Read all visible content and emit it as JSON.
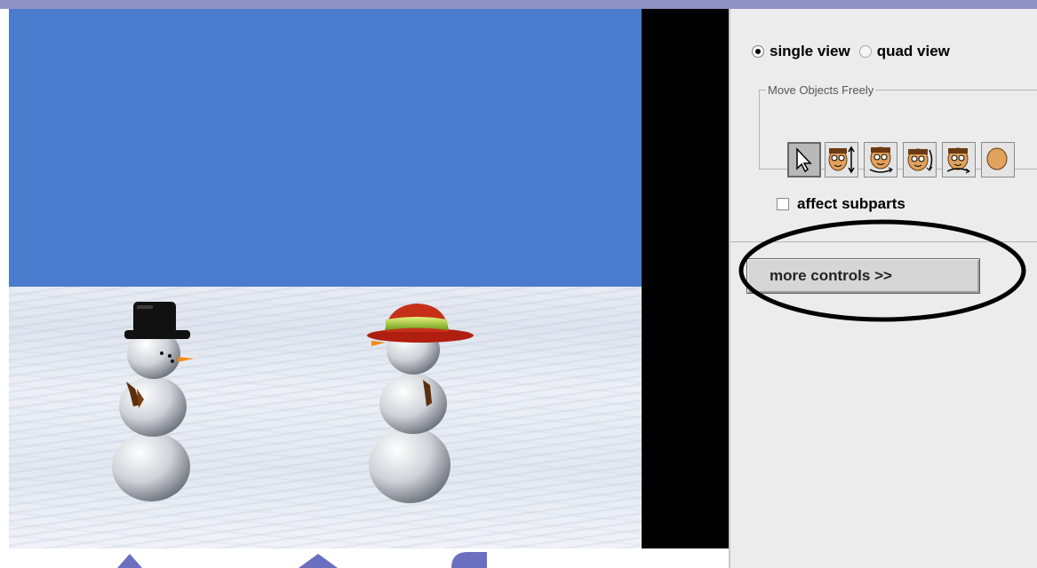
{
  "view_options": {
    "single_label": "single view",
    "quad_label": "quad view",
    "selected": "single view"
  },
  "move_group": {
    "title": "Move Objects Freely"
  },
  "tools": [
    {
      "icon": "pointer-arrow-icon",
      "selected": true
    },
    {
      "icon": "move-up-down-icon",
      "selected": false
    },
    {
      "icon": "turn-left-right-icon",
      "selected": false
    },
    {
      "icon": "turn-forward-backward-icon",
      "selected": false
    },
    {
      "icon": "roll-icon",
      "selected": false
    }
  ],
  "affect_subparts": {
    "label": "affect subparts",
    "checked": false
  },
  "more_controls": {
    "label": "more controls >>"
  },
  "colors": {
    "sky": "#4a7bcc",
    "snow": "#e9ecf3",
    "panel": "#ececec",
    "callout": "#000000"
  }
}
